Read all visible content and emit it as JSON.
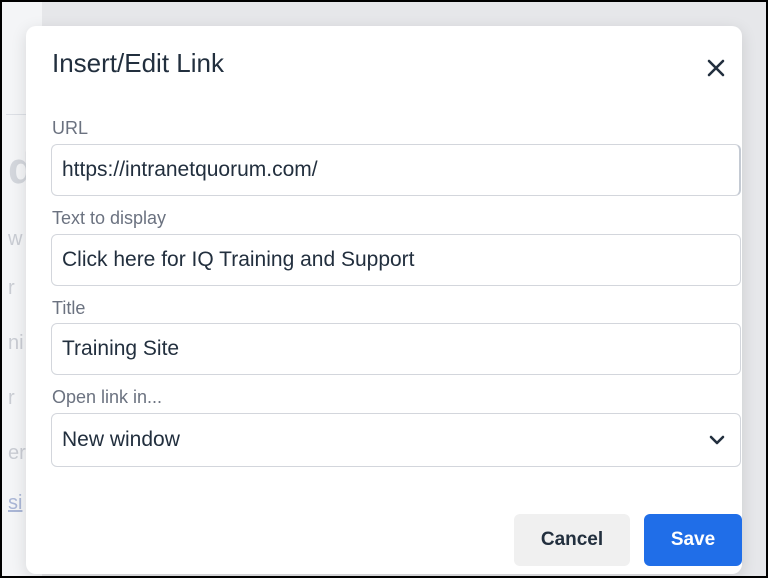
{
  "background_editor": {
    "fragments": [
      "d",
      "w",
      "r",
      "ni",
      "r",
      "er",
      "si"
    ]
  },
  "dialog": {
    "title": "Insert/Edit Link",
    "close_icon": "close-icon",
    "fields": {
      "url": {
        "label": "URL",
        "value": "https://intranetquorum.com/"
      },
      "text_to_display": {
        "label": "Text to display",
        "value": "Click here for IQ Training and Support"
      },
      "title": {
        "label": "Title",
        "value": "Training Site"
      },
      "open_link_in": {
        "label": "Open link in...",
        "selected": "New window",
        "icon": "chevron-down-icon"
      }
    },
    "buttons": {
      "cancel": "Cancel",
      "save": "Save"
    }
  },
  "colors": {
    "accent": "#206ee8",
    "overlay": "#e6e7ea",
    "text": "#222f3e",
    "label": "#6b7280"
  }
}
